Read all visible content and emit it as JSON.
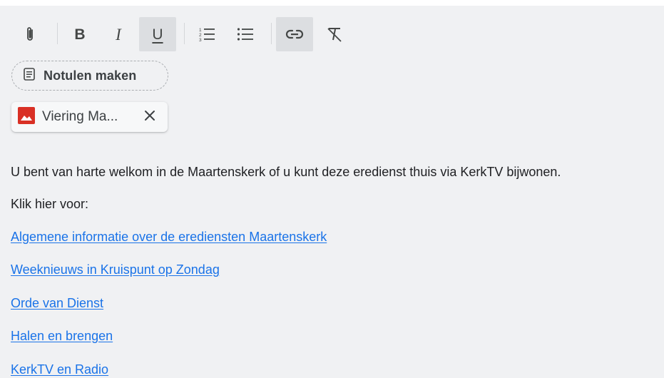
{
  "toolbar": {
    "buttons": [
      {
        "name": "attach-icon"
      },
      {
        "name": "bold-icon",
        "glyph": "B"
      },
      {
        "name": "italic-icon",
        "glyph": "I"
      },
      {
        "name": "underline-icon",
        "glyph": "U",
        "active": true
      },
      {
        "name": "numbered-list-icon"
      },
      {
        "name": "bulleted-list-icon"
      },
      {
        "name": "link-icon",
        "active": true
      },
      {
        "name": "remove-formatting-icon"
      }
    ]
  },
  "notes_chip": {
    "label": "Notulen maken",
    "icon": "notes-icon"
  },
  "attachment": {
    "label": "Viering Ma...",
    "icon": "image-icon",
    "icon_color": "#d93025"
  },
  "content": {
    "intro": "U bent van harte welkom in de Maartenskerk of u kunt deze eredienst thuis via KerkTV bijwonen.",
    "click_here": "Klik hier voor:",
    "links": [
      "Algemene informatie over de erediensten Maartenskerk",
      "Weeknieuws in Kruispunt op Zondag",
      "Orde van Dienst",
      "Halen en brengen",
      "KerkTV en Radio"
    ]
  },
  "colors": {
    "background": "#f0f1f3",
    "link": "#1a73e8",
    "text": "#202124"
  }
}
